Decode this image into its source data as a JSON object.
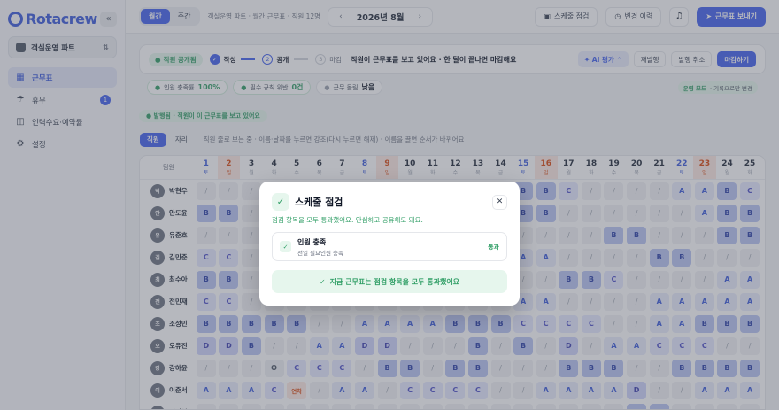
{
  "app": {
    "logo": "Rotacrew",
    "team": "객실운영 파트"
  },
  "nav": [
    {
      "label": "근무표",
      "icon": "calendar-icon",
      "active": true,
      "badge": ""
    },
    {
      "label": "휴무",
      "icon": "beach-icon",
      "active": false,
      "badge": "1"
    },
    {
      "label": "인력수요·예약률",
      "icon": "chart-icon",
      "active": false,
      "badge": ""
    },
    {
      "label": "설정",
      "icon": "gear-icon",
      "active": false,
      "badge": ""
    }
  ],
  "topbar": {
    "view_month": "월간",
    "view_week": "주간",
    "breadcrumb": "객실운영 파트 · 월간 근무표 · 직원 12명",
    "month_label": "2026년 8월",
    "btn_check": "스케줄 점검",
    "btn_history": "변경 이력",
    "btn_send": "근무표 보내기"
  },
  "status": {
    "badge": "직원 공개됨",
    "step1": "작성",
    "step2_num": "2",
    "step2": "공개",
    "step3_num": "3",
    "step3": "마감",
    "message": "직원이 근무표를 보고 있어요 · 한 달이 끝나면 마감해요",
    "ai_label": "AI 평가",
    "btn_republish": "재발행",
    "btn_unpublish": "발행 취소",
    "btn_close": "마감하기"
  },
  "metrics": [
    {
      "label": "인원 충족률",
      "value": "100%"
    },
    {
      "label": "필수 규칙 위반",
      "value": "0건"
    },
    {
      "label": "근무 몰림",
      "value": "낮음"
    }
  ],
  "mode": {
    "label": "운영 모드",
    "desc": "· 기록으로만 변경"
  },
  "notice": "발행됨 · 직원이 이 근무표를 보고 있어요",
  "view": {
    "tab_staff": "직원",
    "tab_seat": "자리",
    "hint": "직원 줄로 보는 중 · 이름·날짜를 누르면 강조(다시 누르면 해제) · 이름을 끌면 순서가 바뀌어요"
  },
  "grid": {
    "header_label": "팀원",
    "days": [
      {
        "d": "1",
        "w": "토",
        "t": "sat"
      },
      {
        "d": "2",
        "w": "일",
        "t": "sun"
      },
      {
        "d": "3",
        "w": "월",
        "t": ""
      },
      {
        "d": "4",
        "w": "화",
        "t": ""
      },
      {
        "d": "5",
        "w": "수",
        "t": ""
      },
      {
        "d": "6",
        "w": "목",
        "t": ""
      },
      {
        "d": "7",
        "w": "금",
        "t": ""
      },
      {
        "d": "8",
        "w": "토",
        "t": "sat"
      },
      {
        "d": "9",
        "w": "일",
        "t": "sun"
      },
      {
        "d": "10",
        "w": "월",
        "t": ""
      },
      {
        "d": "11",
        "w": "화",
        "t": ""
      },
      {
        "d": "12",
        "w": "수",
        "t": ""
      },
      {
        "d": "13",
        "w": "목",
        "t": ""
      },
      {
        "d": "14",
        "w": "금",
        "t": ""
      },
      {
        "d": "15",
        "w": "토",
        "t": "sat"
      },
      {
        "d": "16",
        "w": "일",
        "t": "sun"
      },
      {
        "d": "17",
        "w": "월",
        "t": ""
      },
      {
        "d": "18",
        "w": "화",
        "t": ""
      },
      {
        "d": "19",
        "w": "수",
        "t": ""
      },
      {
        "d": "20",
        "w": "목",
        "t": ""
      },
      {
        "d": "21",
        "w": "금",
        "t": ""
      },
      {
        "d": "22",
        "w": "토",
        "t": "sat"
      },
      {
        "d": "23",
        "w": "일",
        "t": "sun"
      },
      {
        "d": "24",
        "w": "월",
        "t": ""
      },
      {
        "d": "25",
        "w": "화",
        "t": ""
      }
    ],
    "rows": [
      {
        "avatar": "박",
        "name": "박현우",
        "cells": [
          "/",
          "/",
          "/",
          "/",
          "/",
          "/",
          "/",
          "/",
          "/",
          "/",
          "/",
          "/",
          "B",
          "B",
          "B",
          "B",
          "C",
          "/",
          "/",
          "/",
          "/",
          "A",
          "A",
          "B",
          "C"
        ]
      },
      {
        "avatar": "안",
        "name": "안도윤",
        "cells": [
          "B",
          "B",
          "/",
          "/",
          "/",
          "/",
          "/",
          "/",
          "/",
          "/",
          "/",
          "/",
          "/",
          "/",
          "B",
          "B",
          "/",
          "/",
          "/",
          "/",
          "/",
          "/",
          "A",
          "B",
          "B"
        ]
      },
      {
        "avatar": "유",
        "name": "유준호",
        "cells": [
          "/",
          "/",
          "/",
          "/",
          "/",
          "/",
          "/",
          "/",
          "/",
          "/",
          "/",
          "/",
          "/",
          "/",
          "/",
          "/",
          "/",
          "/",
          "B",
          "B",
          "/",
          "/",
          "/",
          "B",
          "B"
        ]
      },
      {
        "avatar": "김",
        "name": "김민준",
        "cells": [
          "C",
          "C",
          "/",
          "/",
          "/",
          "/",
          "/",
          "/",
          "/",
          "/",
          "/",
          "/",
          "/",
          "/",
          "A",
          "A",
          "/",
          "/",
          "/",
          "/",
          "B",
          "B",
          "/",
          "/",
          "/"
        ]
      },
      {
        "avatar": "최",
        "name": "최수아",
        "cells": [
          "B",
          "B",
          "/",
          "/",
          "/",
          "/",
          "/",
          "/",
          "/",
          "/",
          "/",
          "/",
          "/",
          "/",
          "/",
          "/",
          "B",
          "B",
          "C",
          "/",
          "/",
          "/",
          "/",
          "A",
          "A"
        ]
      },
      {
        "avatar": "전",
        "name": "전민재",
        "cells": [
          "C",
          "C",
          "/",
          "/",
          "/",
          "/",
          "/",
          "/",
          "/",
          "/",
          "/",
          "/",
          "/",
          "/",
          "A",
          "A",
          "/",
          "/",
          "/",
          "/",
          "A",
          "A",
          "A",
          "A",
          "A"
        ]
      },
      {
        "avatar": "조",
        "name": "조성민",
        "cells": [
          "B",
          "B",
          "B",
          "B",
          "B",
          "/",
          "/",
          "A",
          "A",
          "A",
          "A",
          "B",
          "B",
          "B",
          "C",
          "C",
          "C",
          "C",
          "/",
          "/",
          "A",
          "A",
          "B",
          "B",
          "B"
        ]
      },
      {
        "avatar": "오",
        "name": "오유진",
        "cells": [
          "D",
          "D",
          "B",
          "/",
          "/",
          "A",
          "A",
          "D",
          "D",
          "/",
          "/",
          "/",
          "B",
          "/",
          "B",
          "/",
          "D",
          "/",
          "A",
          "A",
          "C",
          "C",
          "C",
          "/",
          "/"
        ]
      },
      {
        "avatar": "강",
        "name": "강하윤",
        "cells": [
          "/",
          "/",
          "/",
          "O",
          "C",
          "C",
          "C",
          "/",
          "B",
          "B",
          "/",
          "B",
          "B",
          "/",
          "/",
          "/",
          "B",
          "B",
          "B",
          "/",
          "/",
          "B",
          "B",
          "B",
          "B"
        ]
      },
      {
        "avatar": "이",
        "name": "이준서",
        "cells": [
          "A",
          "A",
          "A",
          "C",
          "연차",
          "/",
          "A",
          "A",
          "/",
          "C",
          "C",
          "C",
          "C",
          "/",
          "/",
          "A",
          "A",
          "A",
          "A",
          "D",
          "/",
          "/",
          "A",
          "A",
          "A"
        ]
      },
      {
        "avatar": "이",
        "name": "이서연",
        "cells": [
          "/",
          "/",
          "/",
          "/",
          "/",
          "/",
          "/",
          "/",
          "/",
          "/",
          "/",
          "/",
          "/",
          "/",
          "/",
          "/",
          "/",
          "/",
          "/",
          "B",
          "B",
          "/",
          "/",
          "/",
          "/"
        ]
      }
    ]
  },
  "modal": {
    "title": "스케줄 점검",
    "subtitle": "점검 항목을 모두 통과했어요. 안심하고 공유해도 돼요.",
    "item_title": "인원 충족",
    "item_desc": "전일 필요인원 충족",
    "item_result": "통과",
    "banner": "지금 근무표는 점검 항목을 모두 통과했어요"
  },
  "colors": {
    "accent": "#4361ee",
    "success": "#2f9e65",
    "sunday": "#d9480f"
  }
}
